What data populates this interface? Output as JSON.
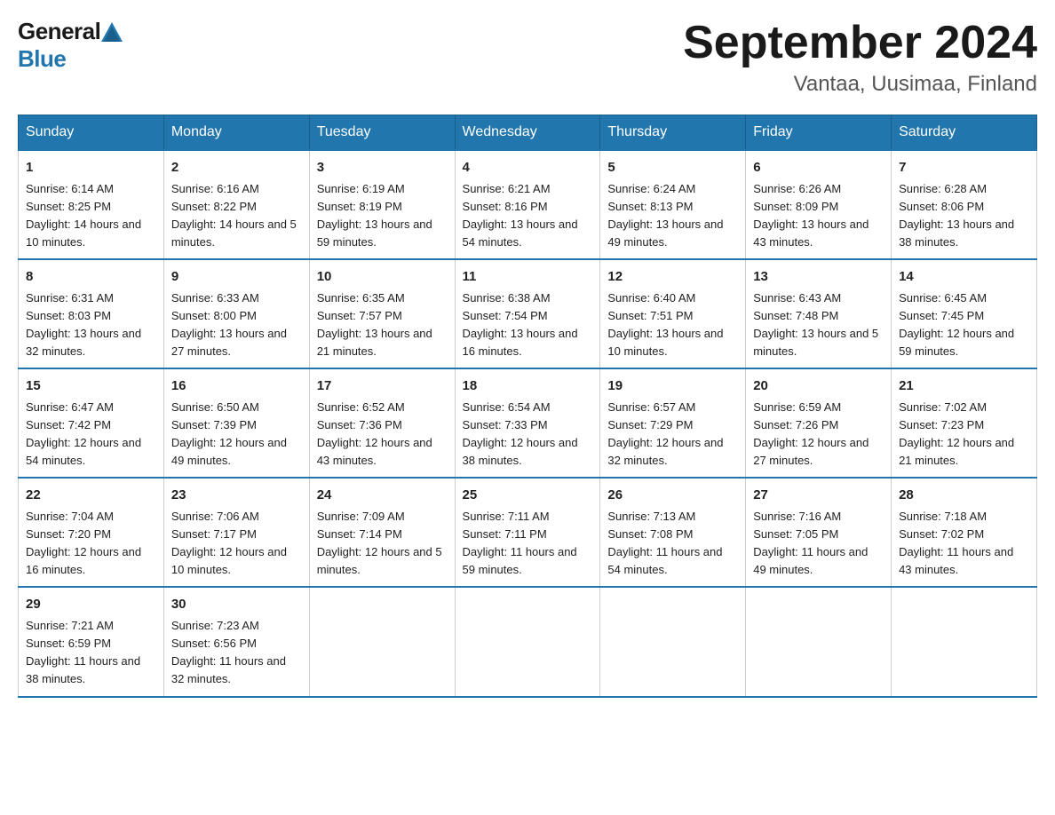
{
  "header": {
    "logo_general": "General",
    "logo_blue": "Blue",
    "month_year": "September 2024",
    "location": "Vantaa, Uusimaa, Finland"
  },
  "days_of_week": [
    "Sunday",
    "Monday",
    "Tuesday",
    "Wednesday",
    "Thursday",
    "Friday",
    "Saturday"
  ],
  "weeks": [
    [
      {
        "day": "1",
        "sunrise": "6:14 AM",
        "sunset": "8:25 PM",
        "daylight": "14 hours and 10 minutes."
      },
      {
        "day": "2",
        "sunrise": "6:16 AM",
        "sunset": "8:22 PM",
        "daylight": "14 hours and 5 minutes."
      },
      {
        "day": "3",
        "sunrise": "6:19 AM",
        "sunset": "8:19 PM",
        "daylight": "13 hours and 59 minutes."
      },
      {
        "day": "4",
        "sunrise": "6:21 AM",
        "sunset": "8:16 PM",
        "daylight": "13 hours and 54 minutes."
      },
      {
        "day": "5",
        "sunrise": "6:24 AM",
        "sunset": "8:13 PM",
        "daylight": "13 hours and 49 minutes."
      },
      {
        "day": "6",
        "sunrise": "6:26 AM",
        "sunset": "8:09 PM",
        "daylight": "13 hours and 43 minutes."
      },
      {
        "day": "7",
        "sunrise": "6:28 AM",
        "sunset": "8:06 PM",
        "daylight": "13 hours and 38 minutes."
      }
    ],
    [
      {
        "day": "8",
        "sunrise": "6:31 AM",
        "sunset": "8:03 PM",
        "daylight": "13 hours and 32 minutes."
      },
      {
        "day": "9",
        "sunrise": "6:33 AM",
        "sunset": "8:00 PM",
        "daylight": "13 hours and 27 minutes."
      },
      {
        "day": "10",
        "sunrise": "6:35 AM",
        "sunset": "7:57 PM",
        "daylight": "13 hours and 21 minutes."
      },
      {
        "day": "11",
        "sunrise": "6:38 AM",
        "sunset": "7:54 PM",
        "daylight": "13 hours and 16 minutes."
      },
      {
        "day": "12",
        "sunrise": "6:40 AM",
        "sunset": "7:51 PM",
        "daylight": "13 hours and 10 minutes."
      },
      {
        "day": "13",
        "sunrise": "6:43 AM",
        "sunset": "7:48 PM",
        "daylight": "13 hours and 5 minutes."
      },
      {
        "day": "14",
        "sunrise": "6:45 AM",
        "sunset": "7:45 PM",
        "daylight": "12 hours and 59 minutes."
      }
    ],
    [
      {
        "day": "15",
        "sunrise": "6:47 AM",
        "sunset": "7:42 PM",
        "daylight": "12 hours and 54 minutes."
      },
      {
        "day": "16",
        "sunrise": "6:50 AM",
        "sunset": "7:39 PM",
        "daylight": "12 hours and 49 minutes."
      },
      {
        "day": "17",
        "sunrise": "6:52 AM",
        "sunset": "7:36 PM",
        "daylight": "12 hours and 43 minutes."
      },
      {
        "day": "18",
        "sunrise": "6:54 AM",
        "sunset": "7:33 PM",
        "daylight": "12 hours and 38 minutes."
      },
      {
        "day": "19",
        "sunrise": "6:57 AM",
        "sunset": "7:29 PM",
        "daylight": "12 hours and 32 minutes."
      },
      {
        "day": "20",
        "sunrise": "6:59 AM",
        "sunset": "7:26 PM",
        "daylight": "12 hours and 27 minutes."
      },
      {
        "day": "21",
        "sunrise": "7:02 AM",
        "sunset": "7:23 PM",
        "daylight": "12 hours and 21 minutes."
      }
    ],
    [
      {
        "day": "22",
        "sunrise": "7:04 AM",
        "sunset": "7:20 PM",
        "daylight": "12 hours and 16 minutes."
      },
      {
        "day": "23",
        "sunrise": "7:06 AM",
        "sunset": "7:17 PM",
        "daylight": "12 hours and 10 minutes."
      },
      {
        "day": "24",
        "sunrise": "7:09 AM",
        "sunset": "7:14 PM",
        "daylight": "12 hours and 5 minutes."
      },
      {
        "day": "25",
        "sunrise": "7:11 AM",
        "sunset": "7:11 PM",
        "daylight": "11 hours and 59 minutes."
      },
      {
        "day": "26",
        "sunrise": "7:13 AM",
        "sunset": "7:08 PM",
        "daylight": "11 hours and 54 minutes."
      },
      {
        "day": "27",
        "sunrise": "7:16 AM",
        "sunset": "7:05 PM",
        "daylight": "11 hours and 49 minutes."
      },
      {
        "day": "28",
        "sunrise": "7:18 AM",
        "sunset": "7:02 PM",
        "daylight": "11 hours and 43 minutes."
      }
    ],
    [
      {
        "day": "29",
        "sunrise": "7:21 AM",
        "sunset": "6:59 PM",
        "daylight": "11 hours and 38 minutes."
      },
      {
        "day": "30",
        "sunrise": "7:23 AM",
        "sunset": "6:56 PM",
        "daylight": "11 hours and 32 minutes."
      },
      null,
      null,
      null,
      null,
      null
    ]
  ]
}
